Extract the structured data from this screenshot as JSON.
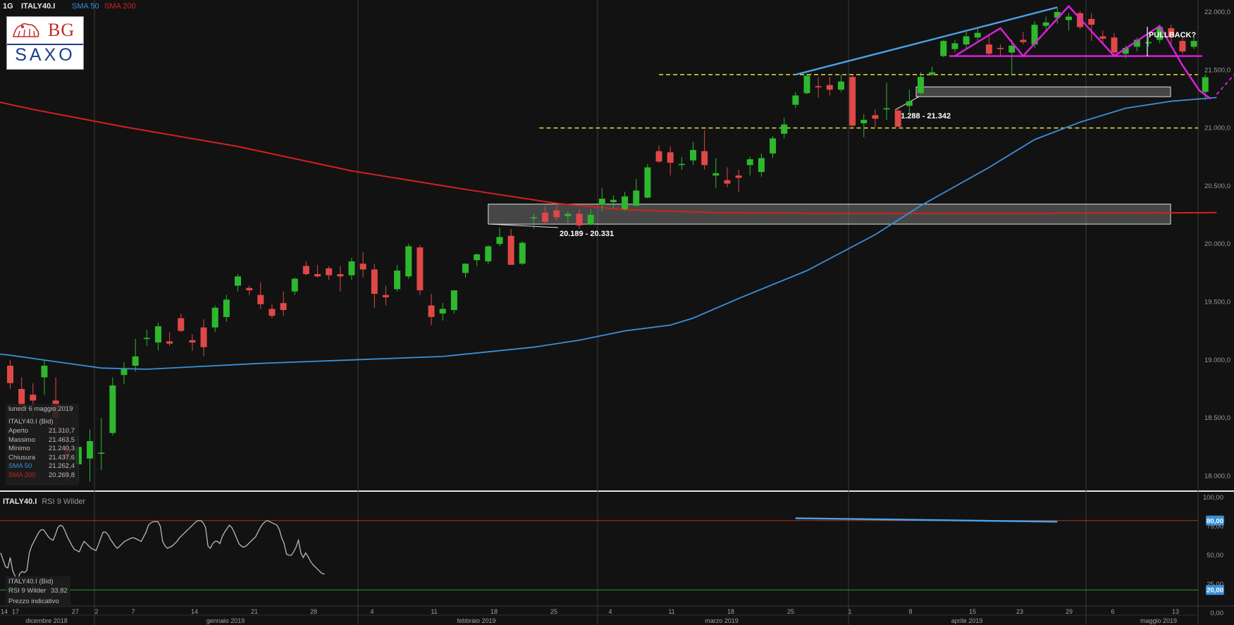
{
  "header": {
    "interval": "1G",
    "symbol": "ITALY40.I",
    "sma50_label": "SMA 50",
    "sma200_label": "SMA 200"
  },
  "logo": {
    "brand_top": "BG",
    "brand_bottom": "SAXO"
  },
  "colors": {
    "background": "#121212",
    "bull_candle": "#2db82d",
    "bear_candle": "#e04848",
    "sma50": "#3a8fd8",
    "sma200": "#d42020",
    "pattern": "#e020e0",
    "trendline": "#4aa3e8",
    "support_dash": "#e8e040",
    "rsi_line": "#b8b8b8",
    "rsi_overbought": "#b03020",
    "rsi_oversold": "#28a028"
  },
  "info_box": {
    "date": "lunedì 6 maggio 2019",
    "instrument": "ITALY40.I (Bid)",
    "rows": [
      {
        "label": "Aperto",
        "value": "21.310,7"
      },
      {
        "label": "Massimo",
        "value": "21.463,5"
      },
      {
        "label": "Minimo",
        "value": "21.240,3"
      },
      {
        "label": "Chiusura",
        "value": "21.437,6"
      },
      {
        "label": "SMA 50",
        "value": "21.262,4"
      },
      {
        "label": "SMA 200",
        "value": "20.269,8"
      }
    ]
  },
  "rsi_panel": {
    "symbol": "ITALY40.I",
    "indicator": "RSI 9 Wilder",
    "info_instrument": "ITALY40.I (Bid)",
    "info_label": "RSI 9 Wilder",
    "info_value": "33,82",
    "info_note": "Prezzo indicativo"
  },
  "chart_data": [
    {
      "type": "candlestick",
      "title": "ITALY40.I",
      "interval": "1G",
      "ylim": [
        17900,
        22100
      ],
      "y_ticks": [
        "22.000,0",
        "21.500,0",
        "21.000,0",
        "20.500,0",
        "20.000,0",
        "19.500,0",
        "19.000,0",
        "18.500,0",
        "18.000,0"
      ],
      "x_day_ticks": [
        "14",
        "17",
        "27",
        "2",
        "7",
        "14",
        "21",
        "28",
        "4",
        "11",
        "18",
        "25",
        "4",
        "11",
        "18",
        "25",
        "1",
        "8",
        "15",
        "23",
        "29",
        "6",
        "13"
      ],
      "x_month_labels": [
        "dicembre 2018",
        "gennaio 2019",
        "febbraio 2019",
        "marzo 2019",
        "aprile 2019",
        "maggio 2019"
      ],
      "candles": [
        {
          "o": 18950,
          "h": 19000,
          "l": 18750,
          "c": 18800
        },
        {
          "o": 18750,
          "h": 18850,
          "l": 18400,
          "c": 18600
        },
        {
          "o": 18700,
          "h": 18800,
          "l": 18500,
          "c": 18650
        },
        {
          "o": 18850,
          "h": 19000,
          "l": 18700,
          "c": 18950
        },
        {
          "o": 18650,
          "h": 18850,
          "l": 18300,
          "c": 18500
        },
        {
          "o": 18250,
          "h": 18400,
          "l": 17950,
          "c": 18150
        },
        {
          "o": 18100,
          "h": 18350,
          "l": 17950,
          "c": 18250
        },
        {
          "o": 18150,
          "h": 18400,
          "l": 17950,
          "c": 18300
        },
        {
          "o": 18200,
          "h": 18500,
          "l": 18050,
          "c": 18200
        },
        {
          "o": 18370,
          "h": 18850,
          "l": 18350,
          "c": 18780
        },
        {
          "o": 18870,
          "h": 18980,
          "l": 18790,
          "c": 18920
        },
        {
          "o": 18950,
          "h": 19180,
          "l": 18900,
          "c": 19030
        },
        {
          "o": 19180,
          "h": 19260,
          "l": 19120,
          "c": 19190
        },
        {
          "o": 19150,
          "h": 19320,
          "l": 19080,
          "c": 19290
        },
        {
          "o": 19160,
          "h": 19240,
          "l": 19120,
          "c": 19140
        },
        {
          "o": 19360,
          "h": 19400,
          "l": 19240,
          "c": 19250
        },
        {
          "o": 19170,
          "h": 19220,
          "l": 19080,
          "c": 19150
        },
        {
          "o": 19280,
          "h": 19350,
          "l": 19030,
          "c": 19110
        },
        {
          "o": 19280,
          "h": 19470,
          "l": 19240,
          "c": 19450
        },
        {
          "o": 19370,
          "h": 19560,
          "l": 19330,
          "c": 19520
        },
        {
          "o": 19640,
          "h": 19740,
          "l": 19590,
          "c": 19720
        },
        {
          "o": 19620,
          "h": 19640,
          "l": 19560,
          "c": 19600
        },
        {
          "o": 19560,
          "h": 19670,
          "l": 19440,
          "c": 19480
        },
        {
          "o": 19440,
          "h": 19480,
          "l": 19360,
          "c": 19380
        },
        {
          "o": 19490,
          "h": 19590,
          "l": 19380,
          "c": 19430
        },
        {
          "o": 19590,
          "h": 19710,
          "l": 19560,
          "c": 19700
        },
        {
          "o": 19810,
          "h": 19850,
          "l": 19730,
          "c": 19740
        },
        {
          "o": 19740,
          "h": 19820,
          "l": 19710,
          "c": 19720
        },
        {
          "o": 19790,
          "h": 19810,
          "l": 19690,
          "c": 19730
        },
        {
          "o": 19740,
          "h": 19810,
          "l": 19590,
          "c": 19720
        },
        {
          "o": 19730,
          "h": 19880,
          "l": 19690,
          "c": 19850
        },
        {
          "o": 19830,
          "h": 19930,
          "l": 19710,
          "c": 19780
        },
        {
          "o": 19780,
          "h": 19830,
          "l": 19450,
          "c": 19570
        },
        {
          "o": 19560,
          "h": 19640,
          "l": 19470,
          "c": 19540
        },
        {
          "o": 19610,
          "h": 19820,
          "l": 19590,
          "c": 19770
        },
        {
          "o": 19720,
          "h": 20000,
          "l": 19700,
          "c": 19980
        },
        {
          "o": 19970,
          "h": 19990,
          "l": 19560,
          "c": 19600
        },
        {
          "o": 19470,
          "h": 19570,
          "l": 19300,
          "c": 19370
        },
        {
          "o": 19400,
          "h": 19490,
          "l": 19340,
          "c": 19440
        },
        {
          "o": 19430,
          "h": 19570,
          "l": 19400,
          "c": 19600
        },
        {
          "o": 19750,
          "h": 19830,
          "l": 19710,
          "c": 19830
        },
        {
          "o": 19860,
          "h": 19920,
          "l": 19810,
          "c": 19910
        },
        {
          "o": 19850,
          "h": 19990,
          "l": 19830,
          "c": 19980
        },
        {
          "o": 20000,
          "h": 20140,
          "l": 19980,
          "c": 20060
        },
        {
          "o": 20070,
          "h": 20130,
          "l": 19930,
          "c": 19820
        },
        {
          "o": 19830,
          "h": 20020,
          "l": 19820,
          "c": 20010
        },
        {
          "o": 20220,
          "h": 20260,
          "l": 20130,
          "c": 20230
        },
        {
          "o": 20270,
          "h": 20330,
          "l": 20170,
          "c": 20190
        },
        {
          "o": 20290,
          "h": 20330,
          "l": 20200,
          "c": 20230
        },
        {
          "o": 20240,
          "h": 20280,
          "l": 20180,
          "c": 20260
        },
        {
          "o": 20260,
          "h": 20300,
          "l": 20130,
          "c": 20160
        },
        {
          "o": 20170,
          "h": 20300,
          "l": 20160,
          "c": 20250
        },
        {
          "o": 20340,
          "h": 20480,
          "l": 20280,
          "c": 20390
        },
        {
          "o": 20360,
          "h": 20420,
          "l": 20310,
          "c": 20380
        },
        {
          "o": 20300,
          "h": 20450,
          "l": 20290,
          "c": 20410
        },
        {
          "o": 20330,
          "h": 20560,
          "l": 20320,
          "c": 20460
        },
        {
          "o": 20400,
          "h": 20690,
          "l": 20390,
          "c": 20660
        },
        {
          "o": 20800,
          "h": 20850,
          "l": 20700,
          "c": 20710
        },
        {
          "o": 20790,
          "h": 20840,
          "l": 20590,
          "c": 20700
        },
        {
          "o": 20680,
          "h": 20750,
          "l": 20640,
          "c": 20690
        },
        {
          "o": 20720,
          "h": 20880,
          "l": 20680,
          "c": 20810
        },
        {
          "o": 20800,
          "h": 20980,
          "l": 20640,
          "c": 20680
        },
        {
          "o": 20590,
          "h": 20740,
          "l": 20480,
          "c": 20610
        },
        {
          "o": 20550,
          "h": 20660,
          "l": 20490,
          "c": 20520
        },
        {
          "o": 20590,
          "h": 20640,
          "l": 20450,
          "c": 20570
        },
        {
          "o": 20680,
          "h": 20750,
          "l": 20590,
          "c": 20730
        },
        {
          "o": 20620,
          "h": 20780,
          "l": 20580,
          "c": 20740
        },
        {
          "o": 20780,
          "h": 20930,
          "l": 20740,
          "c": 20910
        },
        {
          "o": 20950,
          "h": 21090,
          "l": 20910,
          "c": 21030
        },
        {
          "o": 21200,
          "h": 21310,
          "l": 21170,
          "c": 21280
        },
        {
          "o": 21300,
          "h": 21470,
          "l": 21290,
          "c": 21450
        },
        {
          "o": 21360,
          "h": 21440,
          "l": 21260,
          "c": 21350
        },
        {
          "o": 21370,
          "h": 21440,
          "l": 21280,
          "c": 21330
        },
        {
          "o": 21330,
          "h": 21460,
          "l": 21310,
          "c": 21400
        },
        {
          "o": 21440,
          "h": 21450,
          "l": 21010,
          "c": 21020
        },
        {
          "o": 21040,
          "h": 21120,
          "l": 20920,
          "c": 21070
        },
        {
          "o": 21110,
          "h": 21160,
          "l": 21010,
          "c": 21080
        },
        {
          "o": 21160,
          "h": 21390,
          "l": 21070,
          "c": 21170
        },
        {
          "o": 21150,
          "h": 21180,
          "l": 21040,
          "c": 21010
        },
        {
          "o": 21190,
          "h": 21330,
          "l": 21120,
          "c": 21230
        },
        {
          "o": 21300,
          "h": 21480,
          "l": 21290,
          "c": 21440
        },
        {
          "o": 21460,
          "h": 21530,
          "l": 21450,
          "c": 21480
        },
        {
          "o": 21620,
          "h": 21760,
          "l": 21610,
          "c": 21750
        },
        {
          "o": 21680,
          "h": 21760,
          "l": 21650,
          "c": 21730
        },
        {
          "o": 21720,
          "h": 21830,
          "l": 21690,
          "c": 21790
        },
        {
          "o": 21780,
          "h": 21860,
          "l": 21750,
          "c": 21820
        },
        {
          "o": 21720,
          "h": 21790,
          "l": 21620,
          "c": 21640
        },
        {
          "o": 21690,
          "h": 21720,
          "l": 21620,
          "c": 21680
        },
        {
          "o": 21650,
          "h": 21760,
          "l": 21460,
          "c": 21710
        },
        {
          "o": 21760,
          "h": 21830,
          "l": 21720,
          "c": 21740
        },
        {
          "o": 21720,
          "h": 21920,
          "l": 21690,
          "c": 21890
        },
        {
          "o": 21880,
          "h": 21960,
          "l": 21850,
          "c": 21910
        },
        {
          "o": 21950,
          "h": 22040,
          "l": 21900,
          "c": 22000
        },
        {
          "o": 21930,
          "h": 21990,
          "l": 21840,
          "c": 21960
        },
        {
          "o": 21990,
          "h": 22010,
          "l": 21850,
          "c": 21870
        },
        {
          "o": 21940,
          "h": 21990,
          "l": 21750,
          "c": 21890
        },
        {
          "o": 21790,
          "h": 21840,
          "l": 21720,
          "c": 21770
        },
        {
          "o": 21780,
          "h": 21820,
          "l": 21610,
          "c": 21650
        },
        {
          "o": 21640,
          "h": 21710,
          "l": 21600,
          "c": 21690
        },
        {
          "o": 21700,
          "h": 21780,
          "l": 21660,
          "c": 21760
        },
        {
          "o": 21730,
          "h": 21790,
          "l": 21700,
          "c": 21740
        },
        {
          "o": 21760,
          "h": 21890,
          "l": 21730,
          "c": 21870
        },
        {
          "o": 21860,
          "h": 21890,
          "l": 21720,
          "c": 21790
        },
        {
          "o": 21750,
          "h": 21790,
          "l": 21640,
          "c": 21660
        },
        {
          "o": 21700,
          "h": 21790,
          "l": 21680,
          "c": 21750
        },
        {
          "o": 21310.7,
          "h": 21463.5,
          "l": 21240.3,
          "c": 21437.6
        }
      ],
      "sma50_points": [
        [
          -6,
          19110
        ],
        [
          0,
          19040
        ],
        [
          8,
          18930
        ],
        [
          12,
          18920
        ],
        [
          22,
          18970
        ],
        [
          30,
          19000
        ],
        [
          38,
          19030
        ],
        [
          46,
          19110
        ],
        [
          50,
          19170
        ],
        [
          54,
          19250
        ],
        [
          58,
          19300
        ],
        [
          60,
          19360
        ],
        [
          64,
          19530
        ],
        [
          70,
          19770
        ],
        [
          76,
          20080
        ],
        [
          80,
          20330
        ],
        [
          86,
          20660
        ],
        [
          90,
          20900
        ],
        [
          94,
          21050
        ],
        [
          98,
          21170
        ],
        [
          102,
          21230
        ],
        [
          106,
          21262.4
        ]
      ],
      "sma200_points": [
        [
          -6,
          21330
        ],
        [
          2,
          21160
        ],
        [
          10,
          21010
        ],
        [
          20,
          20840
        ],
        [
          30,
          20630
        ],
        [
          40,
          20470
        ],
        [
          48,
          20350
        ],
        [
          54,
          20295
        ],
        [
          62,
          20270
        ],
        [
          74,
          20262
        ],
        [
          90,
          20264
        ],
        [
          106,
          20269.8
        ]
      ],
      "support_zones": [
        {
          "from": 21288,
          "to": 21342,
          "label": "21.288 - 21.342"
        },
        {
          "from": 20189,
          "to": 20331,
          "label": "20.189 - 20.331"
        }
      ],
      "dashed_levels": [
        21460,
        21000
      ],
      "neckline_level": 21620,
      "trendline_points": [
        [
          69,
          21460
        ],
        [
          92,
          22040
        ]
      ],
      "pattern_points": [
        [
          83,
          21620
        ],
        [
          87,
          21860
        ],
        [
          89,
          21620
        ],
        [
          93,
          22050
        ],
        [
          97,
          21620
        ],
        [
          101,
          21880
        ],
        [
          103,
          21540
        ],
        [
          104.5,
          21320
        ],
        [
          105.5,
          21250
        ]
      ],
      "pullback_points": [
        [
          106,
          21290
        ],
        [
          109,
          21620
        ]
      ],
      "annotation": "PULLBACK?"
    },
    {
      "type": "line",
      "title": "RSI 9 Wilder",
      "ylim": [
        0,
        100
      ],
      "y_ticks": [
        "100,00",
        "75,00",
        "50,00",
        "25,00",
        "0,00"
      ],
      "levels": [
        {
          "value": 80,
          "label": "80,00"
        },
        {
          "value": 20,
          "label": "20,00"
        }
      ],
      "divergence_points": [
        [
          69,
          82
        ],
        [
          92,
          79
        ]
      ],
      "values": [
        52,
        46,
        40,
        39,
        48,
        37,
        32,
        27,
        34,
        36,
        35,
        37,
        52,
        58,
        62,
        66,
        70,
        72,
        72,
        69,
        66,
        64,
        63,
        68,
        74,
        76,
        75,
        71,
        66,
        62,
        58,
        55,
        54,
        53,
        58,
        62,
        60,
        58,
        56,
        55,
        54,
        59,
        65,
        70,
        70,
        68,
        64,
        61,
        58,
        56,
        58,
        60,
        62,
        63,
        64,
        65,
        65,
        64,
        63,
        62,
        66,
        70,
        76,
        78,
        79,
        79,
        79,
        75,
        62,
        58,
        56,
        57,
        58,
        60,
        62,
        65,
        67,
        69,
        71,
        73,
        75,
        77,
        79,
        80,
        80,
        78,
        74,
        58,
        56,
        60,
        62,
        62,
        60,
        66,
        70,
        73,
        76,
        74,
        70,
        65,
        60,
        58,
        57,
        58,
        60,
        62,
        64,
        66,
        70,
        74,
        77,
        79,
        80,
        79,
        78,
        77,
        76,
        72,
        65,
        60,
        51,
        50,
        50,
        53,
        57,
        63,
        52,
        48,
        52,
        49,
        45,
        42,
        40,
        38,
        36,
        34,
        33.82
      ]
    }
  ]
}
